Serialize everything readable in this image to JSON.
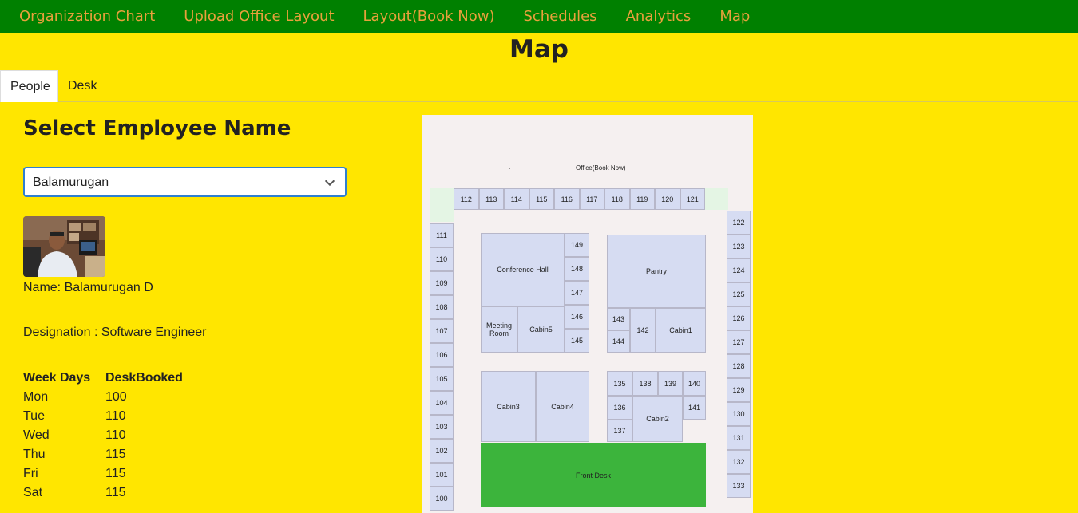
{
  "nav": {
    "items": [
      {
        "label": "Organization Chart"
      },
      {
        "label": "Upload Office Layout"
      },
      {
        "label": "Layout(Book Now)"
      },
      {
        "label": "Schedules"
      },
      {
        "label": "Analytics"
      },
      {
        "label": "Map"
      }
    ]
  },
  "page": {
    "title": "Map"
  },
  "tabs": {
    "people": "People",
    "desk": "Desk"
  },
  "employee": {
    "heading": "Select Employee Name",
    "selected": "Balamurugan",
    "name_line": "Name: Balamurugan D",
    "designation_line": "Designation : Software Engineer"
  },
  "week": {
    "col1": "Week Days",
    "col2": "DeskBooked",
    "rows": [
      {
        "day": "Mon",
        "desk": "100"
      },
      {
        "day": "Tue",
        "desk": "110"
      },
      {
        "day": "Wed",
        "desk": "110"
      },
      {
        "day": "Thu",
        "desk": "115"
      },
      {
        "day": "Fri",
        "desk": "115"
      },
      {
        "day": "Sat",
        "desk": "115"
      }
    ]
  },
  "map": {
    "title": "Office(Book Now)",
    "dot": ".",
    "top_desks": [
      "112",
      "113",
      "114",
      "115",
      "116",
      "117",
      "118",
      "119",
      "120",
      "121"
    ],
    "left_desks": [
      "111",
      "110",
      "109",
      "108",
      "107",
      "106",
      "105",
      "104",
      "103",
      "102",
      "101",
      "100"
    ],
    "right_desks": [
      "122",
      "123",
      "124",
      "125",
      "126",
      "127",
      "128",
      "129",
      "130",
      "131",
      "132",
      "133"
    ],
    "conference": "Conference Hall",
    "conf_side": [
      "149",
      "148",
      "147",
      "146",
      "145"
    ],
    "meeting": "Meeting Room",
    "cabin5": "Cabin5",
    "pantry": "Pantry",
    "d143": "143",
    "d144": "144",
    "d142": "142",
    "cabin1": "Cabin1",
    "cabin3": "Cabin3",
    "cabin4": "Cabin4",
    "d135": "135",
    "d138": "138",
    "d139": "139",
    "d140": "140",
    "d136": "136",
    "d141": "141",
    "d137": "137",
    "cabin2": "Cabin2",
    "front_desk": "Front Desk"
  }
}
